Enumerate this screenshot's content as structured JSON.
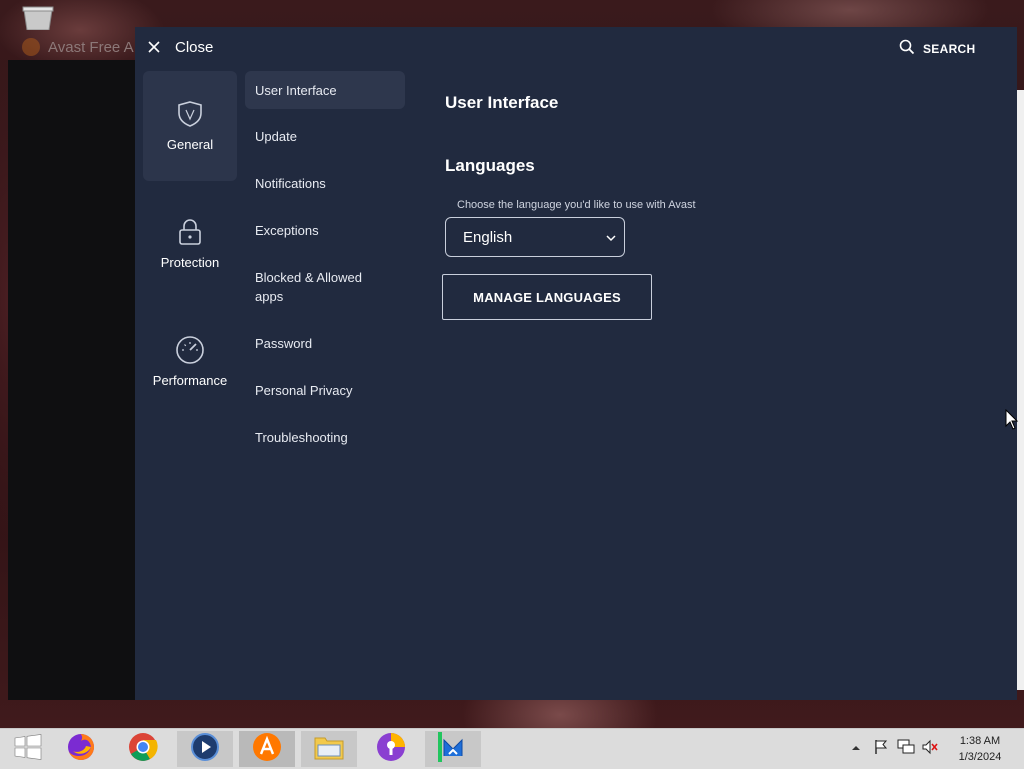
{
  "desktop": {
    "background_window_title": "Avast Free A"
  },
  "panel": {
    "close_label": "Close",
    "search_label": "SEARCH",
    "categories": [
      {
        "label": "General",
        "icon": "shield-icon",
        "active": true
      },
      {
        "label": "Protection",
        "icon": "lock-icon",
        "active": false
      },
      {
        "label": "Performance",
        "icon": "speedometer-icon",
        "active": false
      }
    ],
    "subnav": [
      {
        "label": "User Interface",
        "active": true
      },
      {
        "label": "Update"
      },
      {
        "label": "Notifications"
      },
      {
        "label": "Exceptions"
      },
      {
        "label": "Blocked & Allowed apps"
      },
      {
        "label": "Password"
      },
      {
        "label": "Personal Privacy"
      },
      {
        "label": "Troubleshooting"
      }
    ],
    "content": {
      "title": "User Interface",
      "languages_heading": "Languages",
      "language_hint": "Choose the language you'd like to use with Avast",
      "language_selected": "English",
      "manage_button": "MANAGE LANGUAGES"
    }
  },
  "taskbar": {
    "apps": [
      "windows-start",
      "firefox",
      "chrome",
      "media-player",
      "avast",
      "file-explorer",
      "vpn-lock",
      "malwarebytes"
    ],
    "clock_time": "1:38 AM",
    "clock_date": "1/3/2024"
  },
  "colors": {
    "panel_bg": "#212a3f",
    "active_item_bg": "#2c354b",
    "taskbar_bg": "#dcdcdc"
  }
}
